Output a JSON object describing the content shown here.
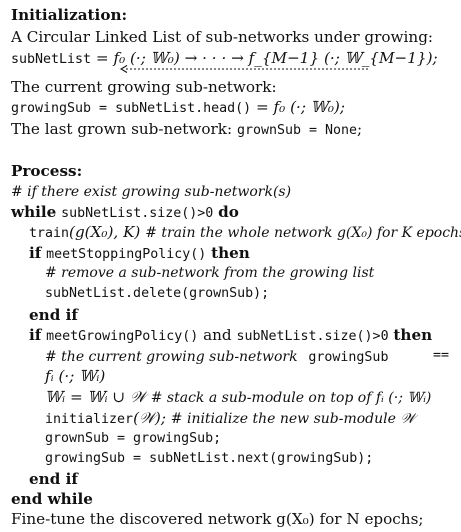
{
  "init": {
    "heading": "Initialization:",
    "desc_list": "A Circular Linked List of sub-networks under growing:",
    "subnet_var": "subNetList",
    "subnet_def": " = f₀ (·; 𝕎₀) → · · · → f_{M−1} (·; 𝕎_{M−1});",
    "desc_current": "The current growing sub-network:",
    "growing_var": "growingSub = subNetList.head()",
    "growing_def": " = f₀ (·; 𝕎₀);",
    "desc_last": "The last grown sub-network:",
    "grown_var": "grownSub = None",
    "grown_end": ";"
  },
  "process": {
    "heading": "Process:",
    "comment_if": "# if there exist growing sub-network(s)",
    "while_kw": "while",
    "while_cond": "subNetList.size()>0",
    "do_kw": "do",
    "train_code": "train",
    "train_args": "(g(X₀), K)",
    "train_comment": "# train the whole network g(X₀) for K epochs",
    "if_kw": "if",
    "stop_policy": "meetStoppingPolicy()",
    "then_kw": "then",
    "remove_comment": "# remove a sub-network from the growing list",
    "delete_code": "subNetList.delete(grownSub);",
    "endif_kw": "end if",
    "grow_policy": "meetGrowingPolicy()",
    "and_kw": "and",
    "grow_cond2": "subNetList.size()>0",
    "current_comment": "# the current growing sub-network",
    "growing_name": "growingSub",
    "eq_sym": "==",
    "fi_expr": "fᵢ (·; 𝕎ᵢ)",
    "stack_expr": "𝕎ᵢ = 𝕎ᵢ ∪ 𝒲",
    "stack_comment": "# stack a sub-module on top of fᵢ (·; 𝕎ᵢ)",
    "init_code": "initializer",
    "init_args": "(𝒲);",
    "init_comment": "# initialize the new sub-module 𝒲",
    "assign_grown": "grownSub = growingSub;",
    "assign_growing": "growingSub = subNetList.next(growingSub);",
    "endwhile_kw": "end while",
    "finetune": "Fine-tune the discovered network g(X₀) for N epochs;"
  }
}
